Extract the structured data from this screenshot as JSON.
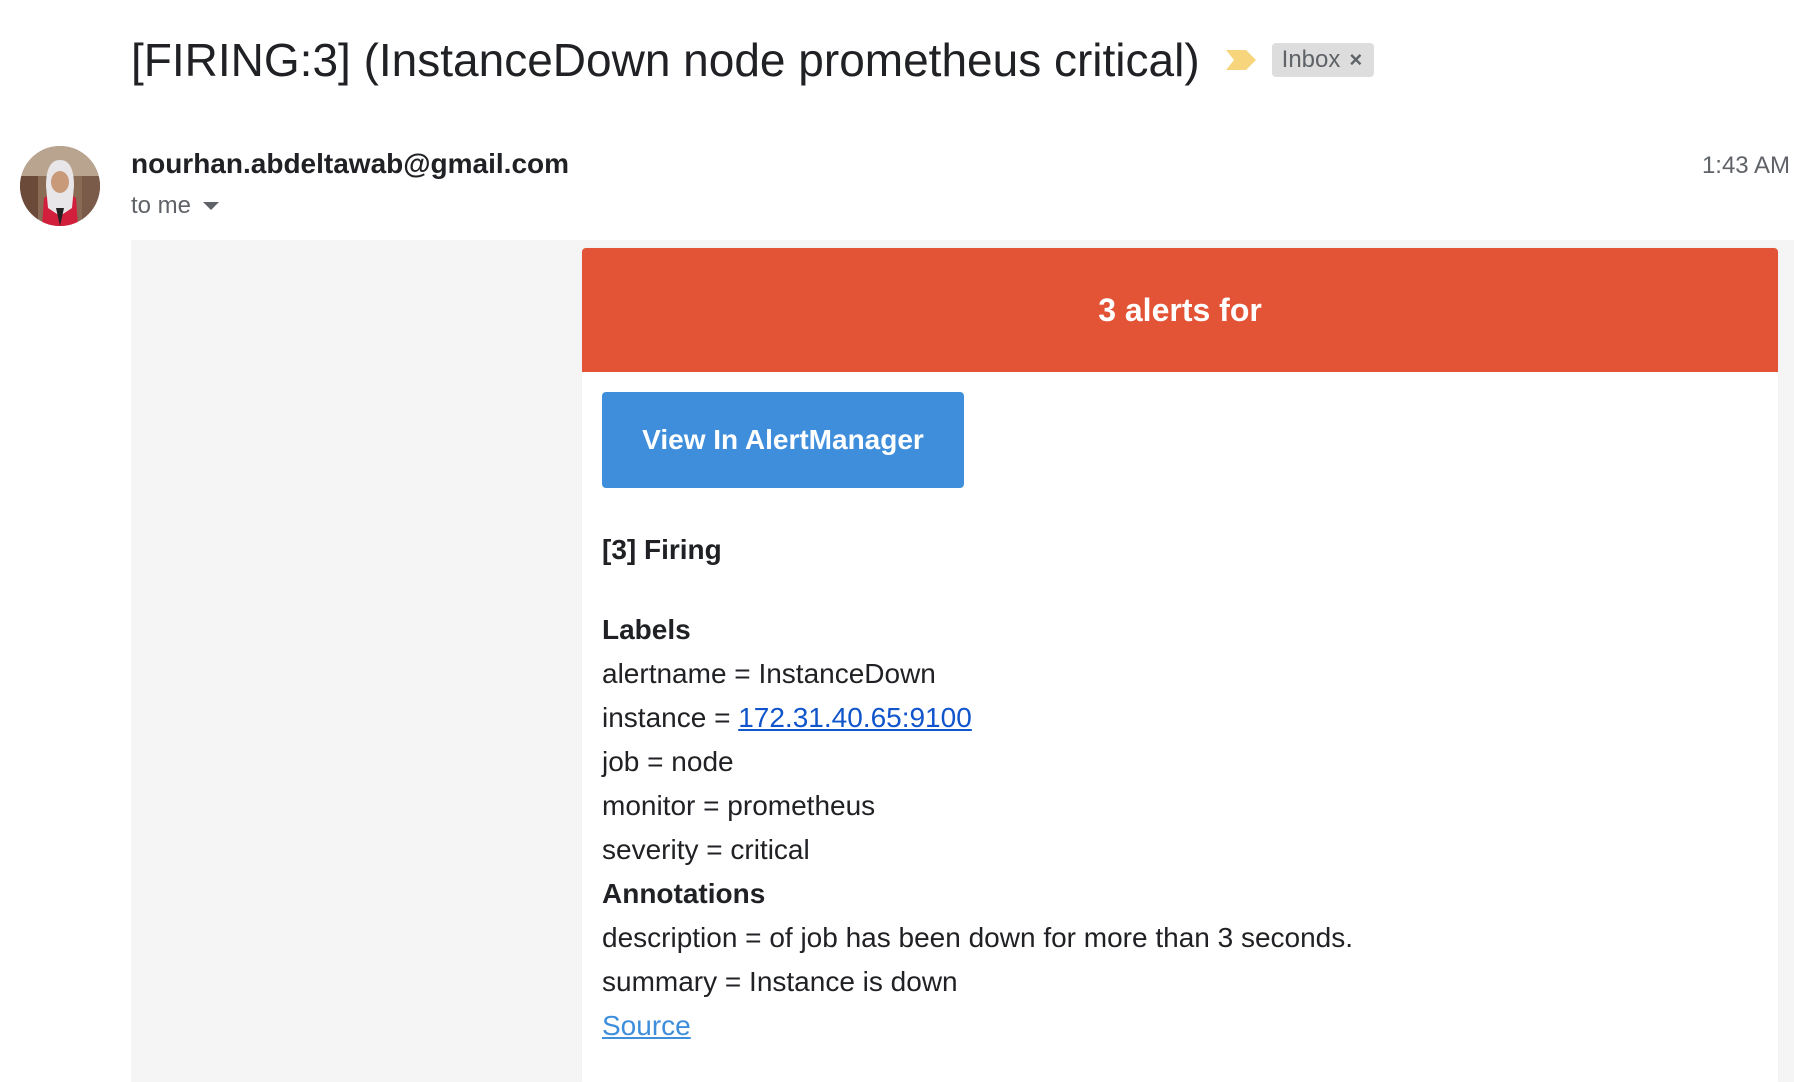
{
  "email": {
    "subject": "[FIRING:3] (InstanceDown node prometheus critical)",
    "label": "Inbox",
    "sender": "nourhan.abdeltawab@gmail.com",
    "recipient": "to me",
    "time": "1:43 AM"
  },
  "alert": {
    "header": "3 alerts for",
    "button_label": "View In AlertManager",
    "firing_title": "[3] Firing",
    "labels_title": "Labels",
    "labels": [
      {
        "key": "alertname",
        "value": "InstanceDown"
      },
      {
        "key": "instance",
        "value": "172.31.40.65:9100"
      },
      {
        "key": "job",
        "value": "node"
      },
      {
        "key": "monitor",
        "value": "prometheus"
      },
      {
        "key": "severity",
        "value": "critical"
      }
    ],
    "annotations_title": "Annotations",
    "annotations": [
      {
        "key": "description",
        "value": "of job has been down for more than 3 seconds."
      },
      {
        "key": "summary",
        "value": "Instance is down"
      }
    ],
    "source_link": "Source"
  },
  "colors": {
    "alert_header": "#e35336",
    "button": "#3e8edb",
    "link": "#1155cc",
    "importance_marker": "#f6d57c"
  }
}
